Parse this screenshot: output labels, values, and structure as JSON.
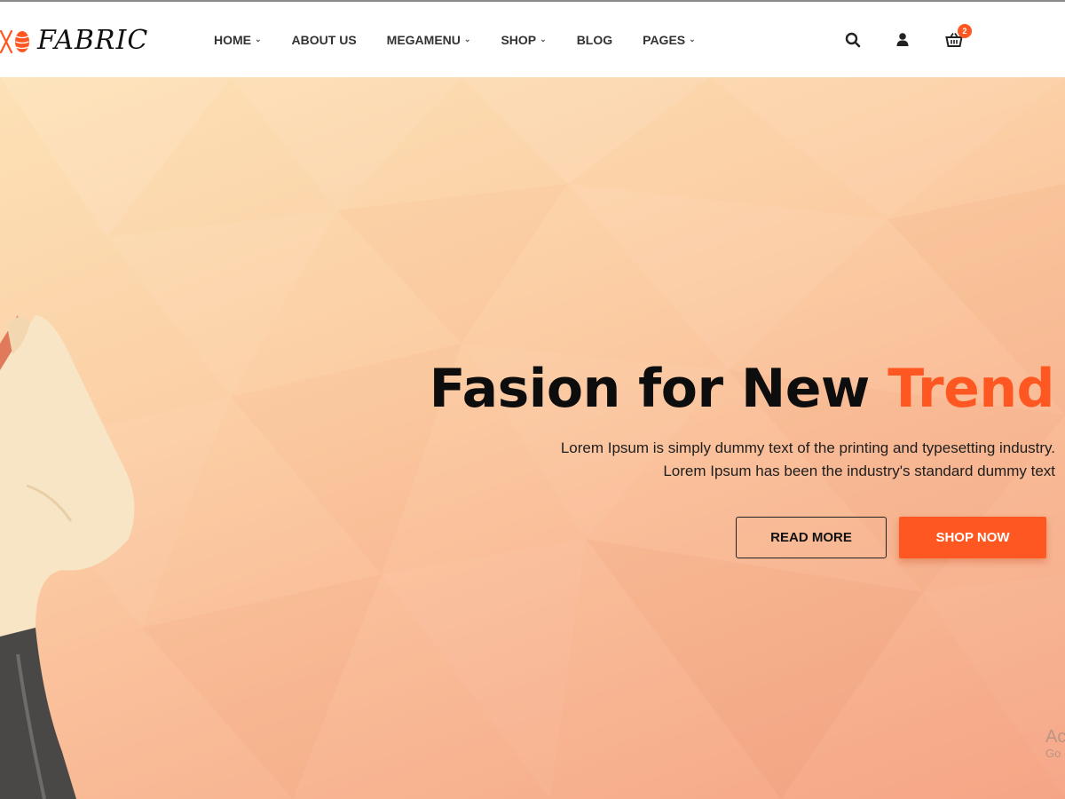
{
  "brand": {
    "name": "FABRIC"
  },
  "nav": {
    "items": [
      {
        "label": "HOME",
        "has_dropdown": true
      },
      {
        "label": "ABOUT US",
        "has_dropdown": false
      },
      {
        "label": "MEGAMENU",
        "has_dropdown": true
      },
      {
        "label": "SHOP",
        "has_dropdown": true
      },
      {
        "label": "BLOG",
        "has_dropdown": false
      },
      {
        "label": "PAGES",
        "has_dropdown": true
      }
    ],
    "icons": [
      "search-icon",
      "user-icon",
      "cart-icon"
    ],
    "cart_count": "2"
  },
  "hero": {
    "title_main": "Fasion for New ",
    "title_accent": "Trend",
    "subtitle_line1": "Lorem Ipsum is simply dummy text of the printing and typesetting industry.",
    "subtitle_line2": "Lorem Ipsum has been the industry's standard dummy text",
    "read_more_label": "READ MORE",
    "shop_now_label": "SHOP NOW"
  },
  "watermark": {
    "line1": "Ac",
    "line2": "Go"
  },
  "colors": {
    "accent": "#ff5722",
    "text_dark": "#0d0d0d",
    "hero_gradient_start": "#fde1b6",
    "hero_gradient_end": "#f5a585"
  }
}
